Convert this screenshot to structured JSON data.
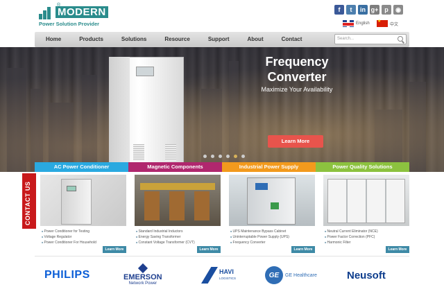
{
  "brand": {
    "name": "MODERN",
    "tagline": "Power Solution Provider",
    "registered": "®",
    "color": "#2a8c8c"
  },
  "social": [
    {
      "icon": "facebook-icon",
      "glyph": "f",
      "color": "#3b5998"
    },
    {
      "icon": "twitter-icon",
      "glyph": "t",
      "color": "#4d7fae"
    },
    {
      "icon": "linkedin-icon",
      "glyph": "in",
      "color": "#3a6fa2"
    },
    {
      "icon": "google-plus-icon",
      "glyph": "g+",
      "color": "#7e7e7e"
    },
    {
      "icon": "pinterest-icon",
      "glyph": "p",
      "color": "#8a8a8a"
    },
    {
      "icon": "rss-icon",
      "glyph": "◉",
      "color": "#8a8a8a"
    }
  ],
  "lang": {
    "english": "English",
    "chinese": "中文"
  },
  "nav": {
    "items": [
      "Home",
      "Products",
      "Solutions",
      "Resource",
      "Support",
      "About",
      "Contact"
    ],
    "search_placeholder": "Search..."
  },
  "hero": {
    "title_line1": "Frequency",
    "title_line2": "Converter",
    "subtitle": "Maximize Your Availability",
    "button": "Learn More",
    "slide_count": 6,
    "active_slide": 5
  },
  "categories": [
    {
      "label": "AC Power Conditioner",
      "color": "#2aa9e0"
    },
    {
      "label": "Magnetic Components",
      "color": "#b0276e"
    },
    {
      "label": "Industrial Power Supply",
      "color": "#f29a1d"
    },
    {
      "label": "Power Quality Solutions",
      "color": "#8cc23f"
    }
  ],
  "contact_tab": "CONTACT US",
  "products": [
    {
      "items": [
        "Power Conditioner for Testing",
        "Voltage Regulator",
        "Power Conditioner For Household"
      ],
      "more": "Learn More"
    },
    {
      "items": [
        "Standard Industrial Inductors",
        "Energy Saving Transformer",
        "Constant Voltage Transformer (CVT)"
      ],
      "more": "Learn More"
    },
    {
      "items": [
        "UPS Maintenance Bypass Cabinet",
        "Uninterruptable Power Supply (UPS)",
        "Frequency Converter"
      ],
      "more": "Learn More"
    },
    {
      "items": [
        "Neutral Current Eliminator (NCE)",
        "Power Factor Correction (PFC)",
        "Harmonic Filter"
      ],
      "more": "Learn More"
    }
  ],
  "partners": {
    "philips": "PHILIPS",
    "emerson": "EMERSON",
    "emerson_sub": "Network Power",
    "havi": "HAVI",
    "havi_sub": "LOGISTICS",
    "ge_mark": "GE",
    "ge": "GE Healthcare",
    "neusoft": "Neusoft"
  }
}
